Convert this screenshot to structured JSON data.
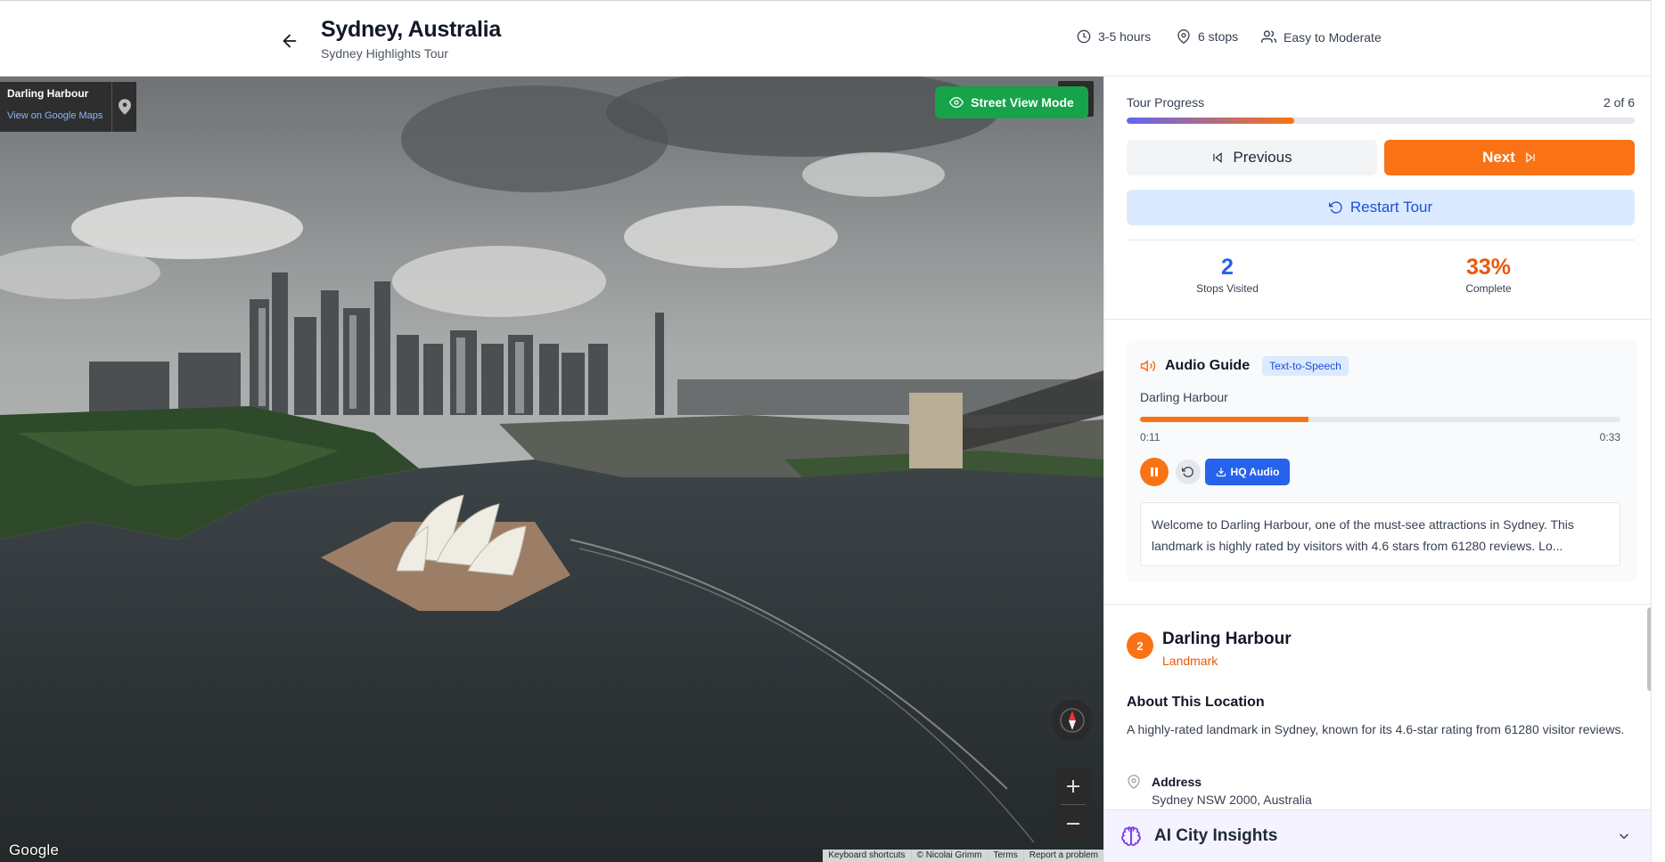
{
  "header": {
    "city_title": "Sydney, Australia",
    "tour_subtitle": "Sydney Highlights Tour",
    "duration": "3-5 hours",
    "stops": "6 stops",
    "difficulty": "Easy to Moderate"
  },
  "viewer": {
    "location_name": "Darling Harbour",
    "maps_link": "View on Google Maps",
    "street_view_label": "Street View Mode",
    "google_logo": "Google",
    "attribution": {
      "shortcuts": "Keyboard shortcuts",
      "credit": "© Nicolai Grimm",
      "terms": "Terms",
      "report": "Report a problem"
    }
  },
  "progress": {
    "label": "Tour Progress",
    "count": "2 of 6",
    "fraction": 0.33,
    "previous_label": "Previous",
    "next_label": "Next",
    "restart_label": "Restart Tour",
    "stops_visited_value": "2",
    "stops_visited_label": "Stops Visited",
    "complete_value": "33%",
    "complete_label": "Complete"
  },
  "audio": {
    "title": "Audio Guide",
    "badge": "Text-to-Speech",
    "location": "Darling Harbour",
    "current_time": "0:11",
    "total_time": "0:33",
    "fraction": 0.35,
    "hq_label": "HQ Audio",
    "transcript": "Welcome to Darling Harbour, one of the must-see attractions in Sydney. This landmark is highly rated by visitors with 4.6 stars from 61280 reviews. Lo..."
  },
  "location": {
    "number": "2",
    "name": "Darling Harbour",
    "category": "Landmark",
    "about_title": "About This Location",
    "about_text": "A highly-rated landmark in Sydney, known for its 4.6-star rating from 61280 visitor reviews.",
    "address_label": "Address",
    "address_value": "Sydney NSW 2000, Australia"
  },
  "insights": {
    "title": "AI City Insights"
  },
  "colors": {
    "accent_orange": "#f97316",
    "accent_blue": "#2563eb",
    "street_view_green": "#16a34a"
  }
}
